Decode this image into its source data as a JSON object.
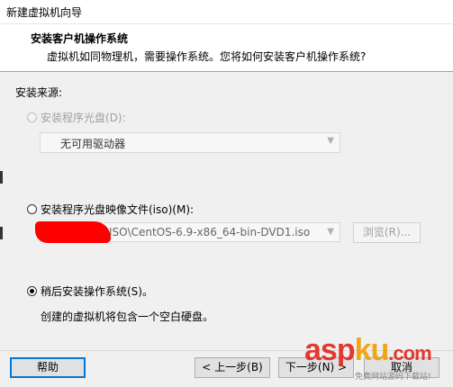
{
  "window": {
    "title": "新建虚拟机向导"
  },
  "header": {
    "title": "安装客户机操作系统",
    "subtitle": "虚拟机如同物理机，需要操作系统。您将如何安装客户机操作系统?"
  },
  "install_source": {
    "label": "安装来源:",
    "options": [
      {
        "label": "安装程序光盘(D):",
        "selected": false,
        "enabled": false
      },
      {
        "label": "安装程序光盘映像文件(iso)(M):",
        "selected": false,
        "enabled": true
      },
      {
        "label": "稍后安装操作系统(S)。",
        "selected": true,
        "enabled": true
      }
    ],
    "drive_select": {
      "value": "无可用驱动器"
    },
    "iso_path": {
      "value": "ISO\\CentOS-6.9-x86_64-bin-DVD1.iso"
    },
    "browse_label": "浏览(R)...",
    "later_description": "创建的虚拟机将包含一个空白硬盘。"
  },
  "footer": {
    "help_label": "帮助",
    "back_label": "< 上一步(B)",
    "next_label": "下一步(N) >",
    "cancel_label": "取消"
  },
  "watermark": {
    "main_a": "asp",
    "main_b": "ku",
    "main_c": ".com",
    "sub": "免费网站源码下载站!"
  }
}
